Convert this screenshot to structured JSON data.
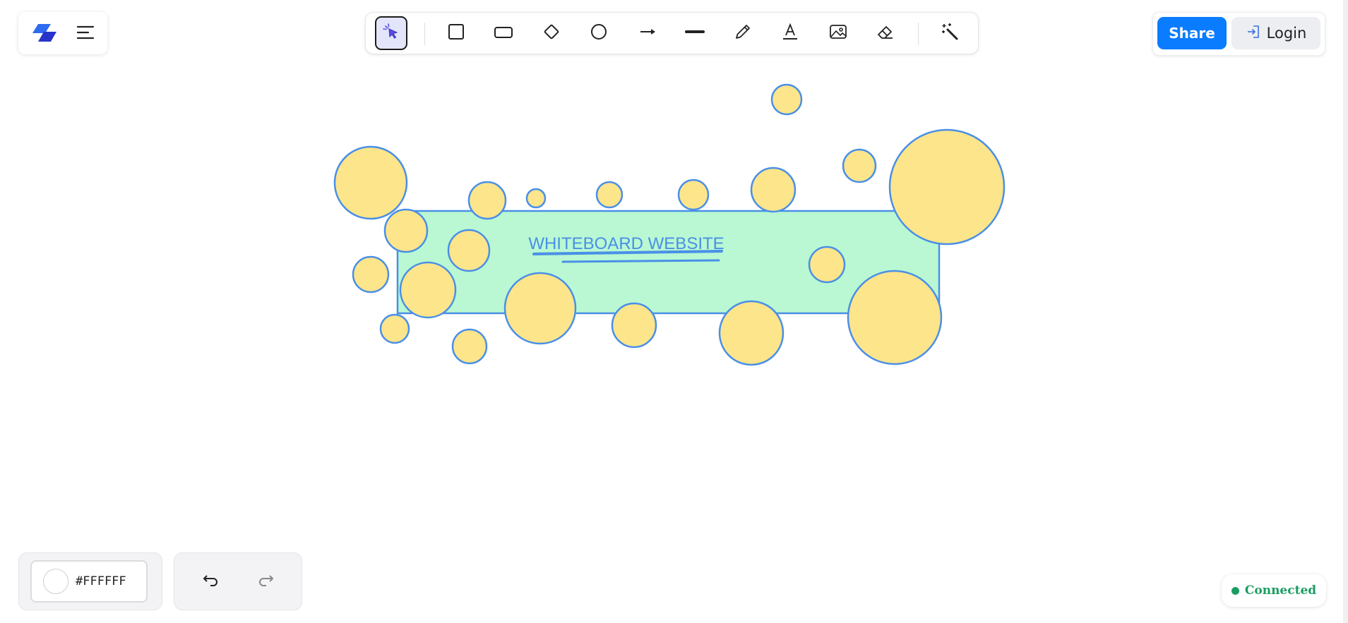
{
  "app": {
    "logo_icon": "app-logo-icon",
    "menu_icon": "hamburger-menu-icon"
  },
  "toolbar": {
    "tools": [
      {
        "name": "select",
        "icon": "cursor-sparkle-icon",
        "active": true
      },
      {
        "name": "square",
        "icon": "square-icon"
      },
      {
        "name": "rectangle",
        "icon": "rectangle-icon"
      },
      {
        "name": "diamond",
        "icon": "diamond-icon"
      },
      {
        "name": "circle",
        "icon": "circle-icon"
      },
      {
        "name": "arrow",
        "icon": "arrow-right-icon"
      },
      {
        "name": "line",
        "icon": "line-icon"
      },
      {
        "name": "pencil",
        "icon": "pencil-icon"
      },
      {
        "name": "text",
        "icon": "text-icon"
      },
      {
        "name": "image",
        "icon": "image-icon"
      },
      {
        "name": "eraser",
        "icon": "eraser-icon"
      },
      {
        "name": "magic",
        "icon": "magic-wand-icon"
      }
    ]
  },
  "header": {
    "share_label": "Share",
    "login_label": "Login",
    "login_icon": "login-icon"
  },
  "canvas": {
    "banner_text": "WHITEBOARD WEBSITE",
    "colors": {
      "rect_fill": "#b9f8d2",
      "stroke": "#4a8fe7",
      "circle_fill": "#fce58a",
      "text": "#4a8fe7"
    }
  },
  "bottom": {
    "color_value": "#FFFFFF",
    "undo_icon": "undo-icon",
    "redo_icon": "redo-icon"
  },
  "status": {
    "label": "Connected",
    "color": "#1a9d63"
  }
}
